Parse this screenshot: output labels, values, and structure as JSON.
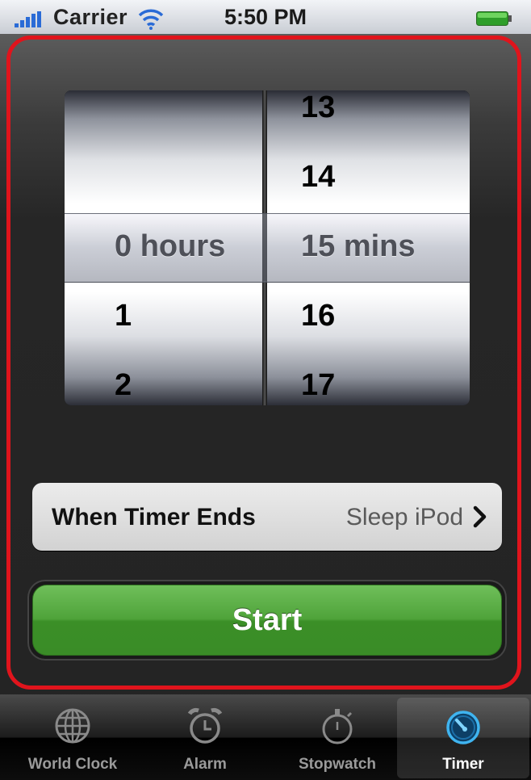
{
  "status_bar": {
    "carrier": "Carrier",
    "time": "5:50 PM",
    "icons": [
      "signal-bars-icon",
      "wifi-icon",
      "battery-icon"
    ]
  },
  "picker": {
    "hours_column": {
      "above": [],
      "selected": "0 hours",
      "below": [
        "1",
        "2"
      ]
    },
    "minutes_column": {
      "above": [
        "13",
        "14"
      ],
      "selected": "15 mins",
      "below": [
        "16",
        "17"
      ]
    }
  },
  "when_timer_ends": {
    "label": "When Timer Ends",
    "value": "Sleep iPod"
  },
  "start_button": {
    "label": "Start"
  },
  "tab_bar": {
    "tabs": [
      {
        "label": "World Clock",
        "icon": "globe-icon",
        "active": false
      },
      {
        "label": "Alarm",
        "icon": "alarm-clock-icon",
        "active": false
      },
      {
        "label": "Stopwatch",
        "icon": "stopwatch-icon",
        "active": false
      },
      {
        "label": "Timer",
        "icon": "timer-icon",
        "active": true
      }
    ]
  },
  "colors": {
    "highlight_border": "#e0141c",
    "start_green": "#4fa33a"
  }
}
